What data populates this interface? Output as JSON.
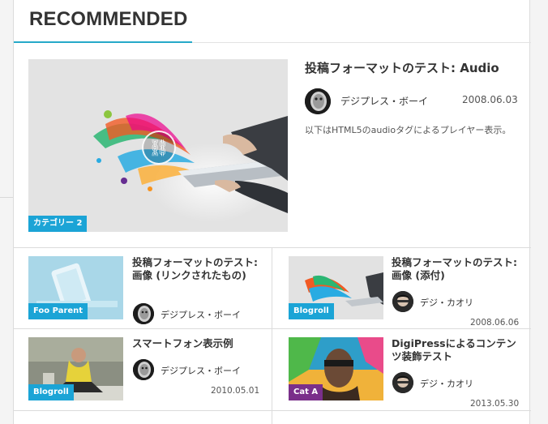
{
  "section": {
    "title": "RECOMMENDED"
  },
  "featured": {
    "title": "投稿フォーマットのテスト: Audio",
    "author": "デジプレス・ボーイ",
    "date": "2008.06.03",
    "excerpt": "以下はHTML5のaudioタグによるプレイヤー表示。",
    "category": "カテゴリー 2",
    "link_icon": "link-icon"
  },
  "posts": [
    {
      "title": "投稿フォーマットのテスト: 画像 (リンクされたもの)",
      "author": "デジプレス・ボーイ",
      "date": "",
      "category": "Foo Parent",
      "category_color": "#1ba4d6"
    },
    {
      "title": "投稿フォーマットのテスト: 画像 (添付)",
      "author": "デジ・カオリ",
      "date": "2008.06.06",
      "category": "Blogroll",
      "category_color": "#1ba4d6"
    },
    {
      "title": "スマートフォン表示例",
      "author": "デジプレス・ボーイ",
      "date": "2010.05.01",
      "category": "Blogroll",
      "category_color": "#1ba4d6"
    },
    {
      "title": "DigiPressによるコンテンツ装飾テスト",
      "author": "デジ・カオリ",
      "date": "2013.05.30",
      "category": "Cat A",
      "category_color": "#7a2f8a"
    }
  ],
  "colors": {
    "accent": "#26a9c9",
    "badge_blue": "#1ba4d6",
    "badge_purple": "#7a2f8a"
  }
}
